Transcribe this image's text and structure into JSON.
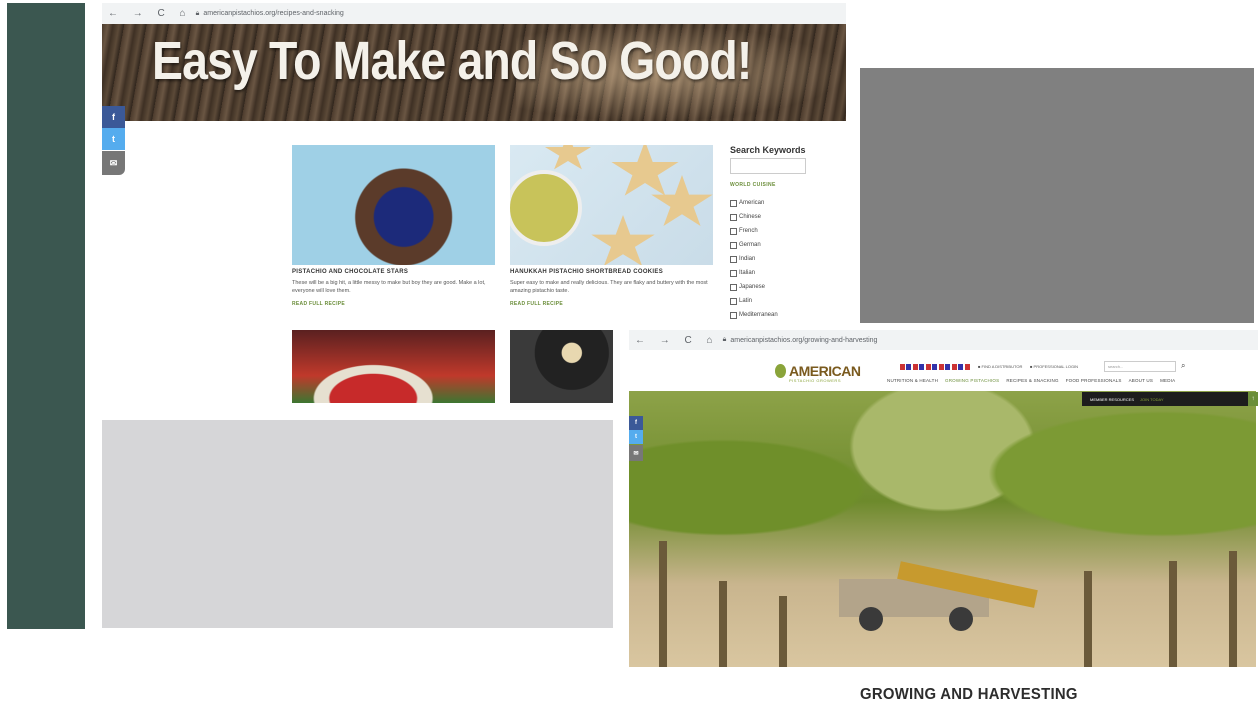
{
  "colors": {
    "left_band": "#3b5750",
    "gray_top": "#808080",
    "gray_bottom": "#d6d6d8",
    "accent_green": "#6b8e3a"
  },
  "shot1": {
    "browser": {
      "nav": "← → C ⌂",
      "lock_icon": "lock-icon",
      "url": "americanpistachios.org/recipes-and-snacking"
    },
    "hero_title": "Easy To Make and So Good!",
    "social": {
      "facebook": "f",
      "twitter": "t",
      "email": "✉"
    },
    "cards": [
      {
        "title": "PISTACHIO AND CHOCOLATE STARS",
        "desc": "These will be a big hit, a little messy to make but boy they are good. Make a lot, everyone will love them.",
        "link": "READ FULL RECIPE"
      },
      {
        "title": "HANUKKAH PISTACHIO SHORTBREAD COOKIES",
        "desc": "Super easy to make and really delicious. They are flaky and buttery with the most amazing pistachio taste.",
        "link": "READ FULL RECIPE"
      }
    ],
    "sidebar": {
      "title": "Search Keywords",
      "category": "WORLD CUISINE",
      "options": [
        "American",
        "Chinese",
        "French",
        "German",
        "Indian",
        "Italian",
        "Japanese",
        "Latin",
        "Mediterranean"
      ]
    }
  },
  "shot2": {
    "browser": {
      "nav": "← → C ⌂",
      "url": "americanpistachios.org/growing-and-harvesting"
    },
    "logo": {
      "name": "AMERICAN",
      "sub": "PISTACHIO GROWERS"
    },
    "util1": "■ FIND A DISTRIBUTOR",
    "util2": "■ PROFESSIONAL LOGIN",
    "search_placeholder": "search...",
    "nav": [
      "NUTRITION & HEALTH",
      "GROWING PISTACHIOS",
      "RECIPES & SNACKING",
      "FOOD PROFESSIONALS",
      "ABOUT US",
      "MEDIA"
    ],
    "members": {
      "label": "MEMBER RESOURCES",
      "join": "JOIN TODAY",
      "arrow": "↑"
    },
    "social": {
      "facebook": "f",
      "twitter": "t",
      "email": "✉"
    }
  },
  "caption": "GROWING AND HARVESTING"
}
